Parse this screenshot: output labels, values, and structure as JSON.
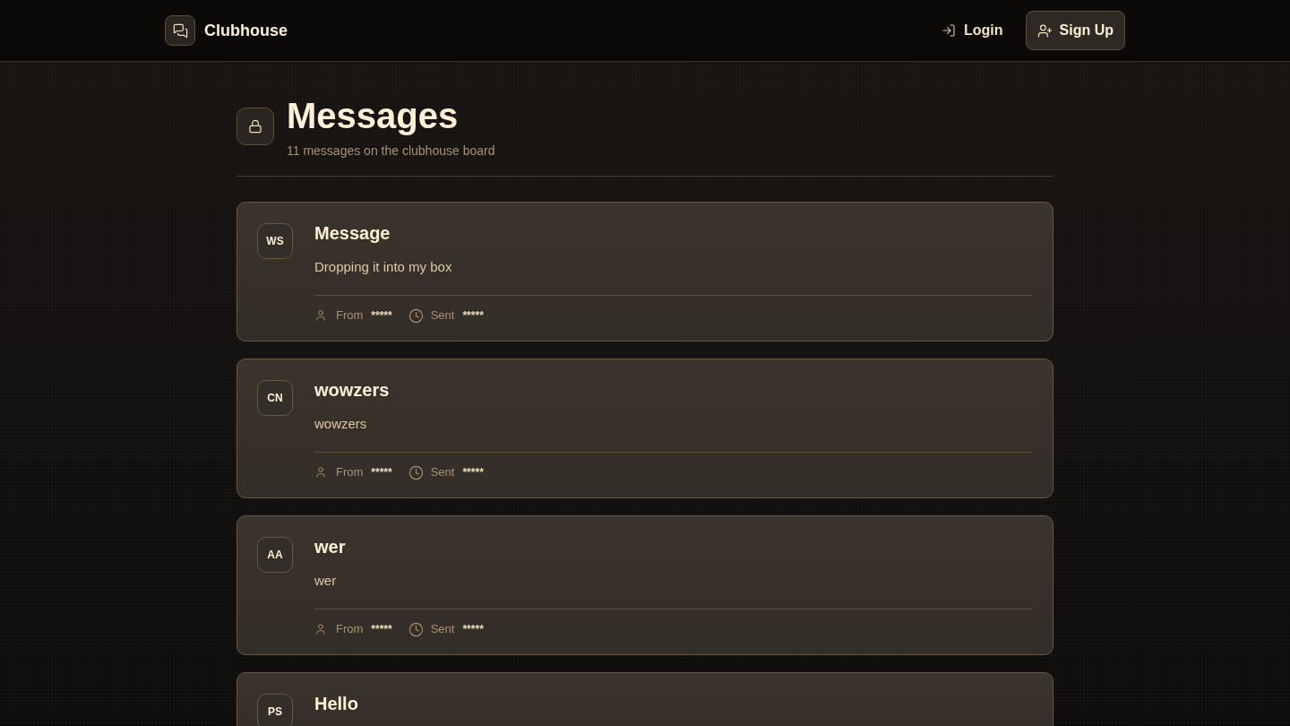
{
  "header": {
    "brand": "Clubhouse",
    "nav": [
      {
        "kind": "link",
        "label": "Login"
      },
      {
        "kind": "button",
        "label": "Sign Up"
      }
    ]
  },
  "page": {
    "title": "Messages",
    "subtitle": "11 messages on the clubhouse board"
  },
  "messages": [
    {
      "initials": "WS",
      "title": "Message",
      "body": "Dropping it into my box",
      "meta": [
        {
          "kind": "author",
          "label": "From",
          "value": "*****"
        },
        {
          "kind": "time",
          "label": "Sent",
          "value": "*****"
        }
      ]
    },
    {
      "initials": "CN",
      "title": "wowzers",
      "body": "wowzers",
      "meta": [
        {
          "kind": "author",
          "label": "From",
          "value": "*****"
        },
        {
          "kind": "time",
          "label": "Sent",
          "value": "*****"
        }
      ]
    },
    {
      "initials": "AA",
      "title": "wer",
      "body": "wer",
      "meta": [
        {
          "kind": "author",
          "label": "From",
          "value": "*****"
        },
        {
          "kind": "time",
          "label": "Sent",
          "value": "*****"
        }
      ]
    },
    {
      "initials": "PS",
      "title": "Hello"
    }
  ]
}
